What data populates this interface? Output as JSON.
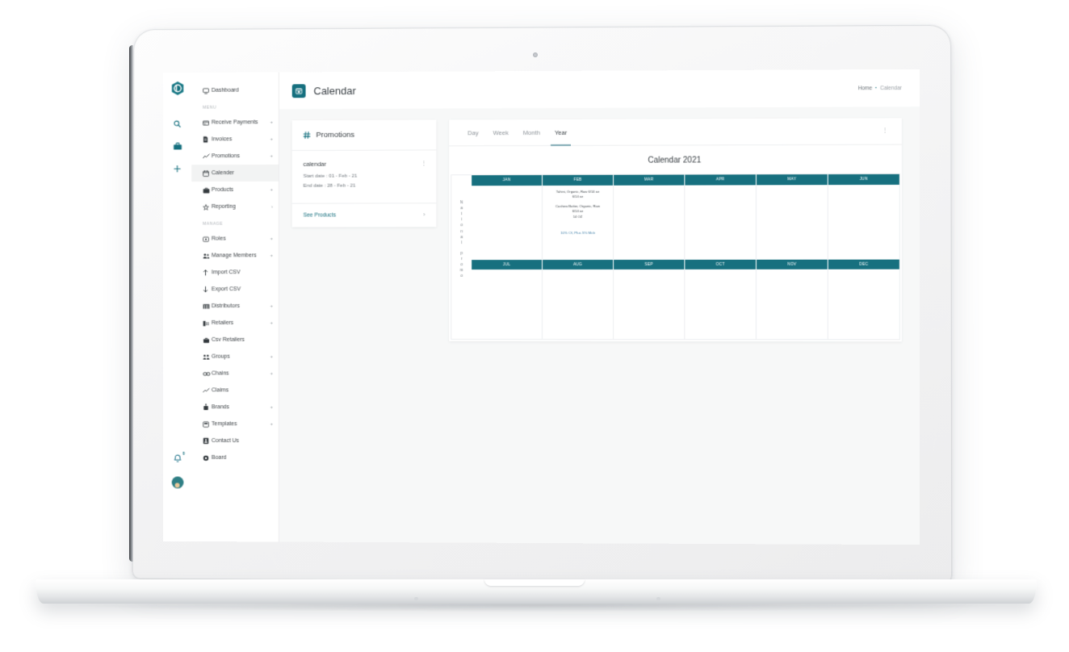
{
  "brand": {
    "logo_letter": "D",
    "accent": "#16707f",
    "teal_header": "#17707f"
  },
  "icon_rail": {
    "items": [
      {
        "name": "search-icon",
        "label": "Search"
      },
      {
        "name": "briefcase-icon",
        "label": "Briefcase"
      },
      {
        "name": "add-icon",
        "label": "Add"
      }
    ],
    "bell_badge": "0"
  },
  "sidebar": {
    "top_items": [
      {
        "label": "Dashboard",
        "icon": "monitor-icon",
        "caret": ""
      }
    ],
    "sections": [
      {
        "title": "MENU",
        "items": [
          {
            "label": "Receive Payments",
            "icon": "payments-icon",
            "caret": "+"
          },
          {
            "label": "Invoices",
            "icon": "invoice-icon",
            "caret": "+"
          },
          {
            "label": "Promotions",
            "icon": "trend-icon",
            "caret": "+"
          },
          {
            "label": "Calender",
            "icon": "calendar-icon",
            "caret": "",
            "active": true
          },
          {
            "label": "Products",
            "icon": "box-icon",
            "caret": "+"
          },
          {
            "label": "Reporting",
            "icon": "report-icon",
            "caret": "›"
          }
        ]
      },
      {
        "title": "MANAGE",
        "items": [
          {
            "label": "Roles",
            "icon": "roles-icon",
            "caret": "+"
          },
          {
            "label": "Manage Members",
            "icon": "members-icon",
            "caret": "+"
          },
          {
            "label": "Import CSV",
            "icon": "import-icon",
            "caret": ""
          },
          {
            "label": "Export CSV",
            "icon": "export-icon",
            "caret": ""
          },
          {
            "label": "Distributors",
            "icon": "distributors-icon",
            "caret": "+"
          },
          {
            "label": "Retailers",
            "icon": "retailers-icon",
            "caret": "+"
          },
          {
            "label": "Csv Retailers",
            "icon": "csv-retailers-icon",
            "caret": ""
          },
          {
            "label": "Groups",
            "icon": "groups-icon",
            "caret": "+"
          },
          {
            "label": "Chains",
            "icon": "chains-icon",
            "caret": "+"
          },
          {
            "label": "Claims",
            "icon": "claims-icon",
            "caret": ""
          },
          {
            "label": "Brands",
            "icon": "brands-icon",
            "caret": "+"
          },
          {
            "label": "Templates",
            "icon": "templates-icon",
            "caret": "+"
          },
          {
            "label": "Contact Us",
            "icon": "contact-icon",
            "caret": ""
          },
          {
            "label": "Board",
            "icon": "board-icon",
            "caret": ""
          }
        ]
      }
    ]
  },
  "topbar": {
    "title": "Calendar",
    "breadcrumb_home": "Home",
    "breadcrumb_sep": "▪",
    "breadcrumb_current": "Calendar"
  },
  "promotions_panel": {
    "title": "Promotions",
    "item": {
      "name": "calendar",
      "start_date": "Start date : 01 - Feb - 21",
      "end_date": "End date : 28 - Feb - 21",
      "kebab": "⋮"
    },
    "see_products_label": "See Products",
    "chevron": "›"
  },
  "calendar": {
    "tabs": [
      {
        "label": "Day",
        "active": false
      },
      {
        "label": "Week",
        "active": false
      },
      {
        "label": "Month",
        "active": false
      },
      {
        "label": "Year",
        "active": true
      }
    ],
    "kebab": "⋮",
    "title": "Calendar 2021",
    "row_label_top": "National",
    "row_label_bottom": "promo",
    "months_first_half": [
      "JAN",
      "FEB",
      "MAR",
      "APR",
      "MAY",
      "JUN"
    ],
    "months_second_half": [
      "JUL",
      "AUG",
      "SEP",
      "OCT",
      "NOV",
      "DEC"
    ],
    "feb_entry": {
      "products": [
        {
          "name": "Tahini, Organic, Raw 6/14 oz",
          "size": "6/14 oz"
        },
        {
          "name": "Cashew Butter, Organic, Raw",
          "size": "6/14 oz",
          "size2": "14 OZ"
        }
      ],
      "discount": "10% OI, Plus 5% Mcb"
    }
  }
}
